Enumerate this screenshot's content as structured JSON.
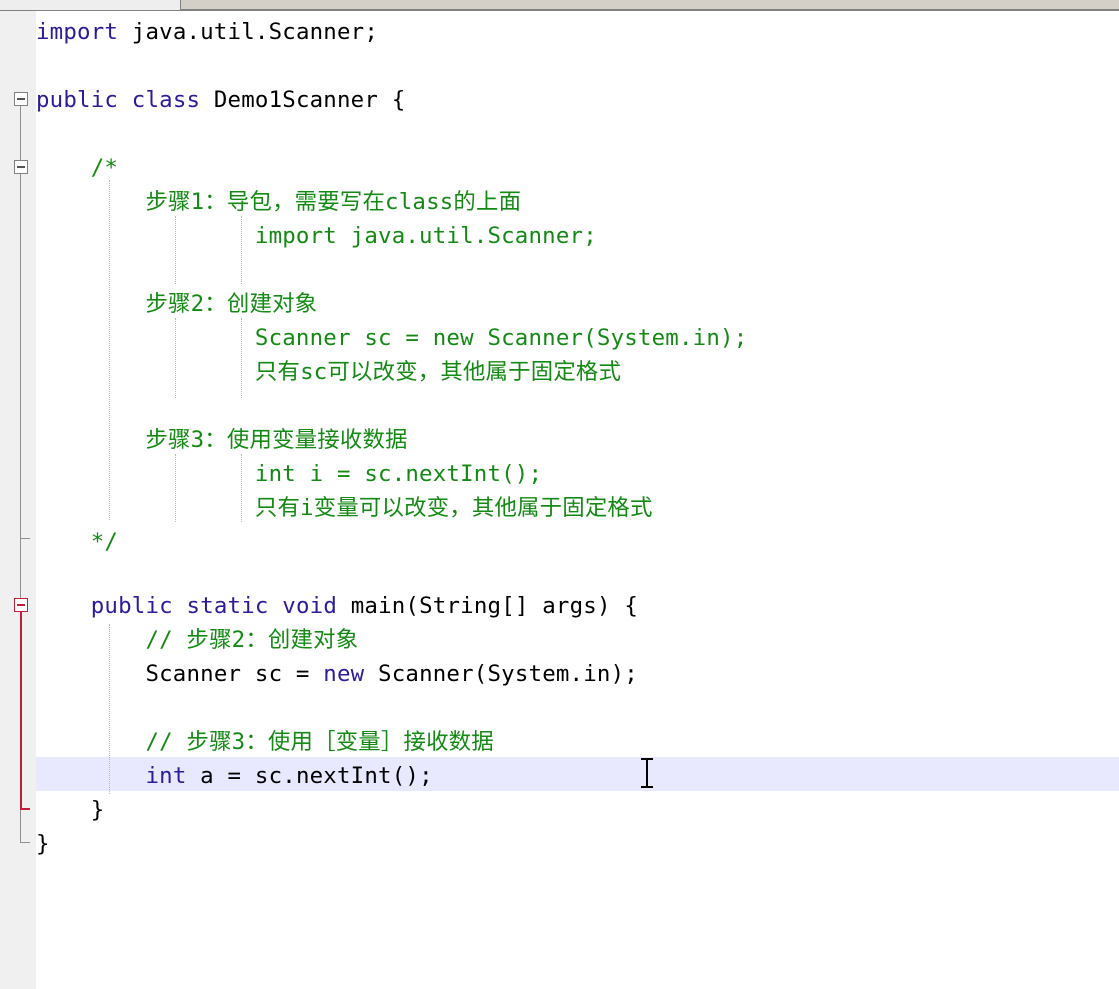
{
  "editor": {
    "lines": [
      {
        "segs": [
          {
            "t": "import",
            "c": "kw"
          },
          {
            "t": " java.util.Scanner;",
            "c": ""
          }
        ]
      },
      {
        "segs": []
      },
      {
        "segs": [
          {
            "t": "public",
            "c": "kw"
          },
          {
            "t": " ",
            "c": ""
          },
          {
            "t": "class",
            "c": "kw"
          },
          {
            "t": " Demo1Scanner {",
            "c": ""
          }
        ]
      },
      {
        "segs": []
      },
      {
        "segs": [
          {
            "t": "    /*",
            "c": "cm"
          }
        ]
      },
      {
        "segs": [
          {
            "t": "        步骤1：导包，需要写在class的上面",
            "c": "cm"
          }
        ]
      },
      {
        "segs": [
          {
            "t": "                import java.util.Scanner;",
            "c": "cm"
          }
        ]
      },
      {
        "segs": []
      },
      {
        "segs": [
          {
            "t": "        步骤2：创建对象",
            "c": "cm"
          }
        ]
      },
      {
        "segs": [
          {
            "t": "                Scanner sc = new Scanner(System.in);",
            "c": "cm"
          }
        ]
      },
      {
        "segs": [
          {
            "t": "                只有sc可以改变，其他属于固定格式",
            "c": "cm"
          }
        ]
      },
      {
        "segs": []
      },
      {
        "segs": [
          {
            "t": "        步骤3：使用变量接收数据",
            "c": "cm"
          }
        ]
      },
      {
        "segs": [
          {
            "t": "                int i = sc.nextInt();",
            "c": "cm"
          }
        ]
      },
      {
        "segs": [
          {
            "t": "                只有i变量可以改变，其他属于固定格式",
            "c": "cm"
          }
        ]
      },
      {
        "segs": [
          {
            "t": "    */",
            "c": "cm"
          }
        ]
      },
      {
        "segs": []
      },
      {
        "segs": [
          {
            "t": "    ",
            "c": ""
          },
          {
            "t": "public",
            "c": "kw"
          },
          {
            "t": " ",
            "c": ""
          },
          {
            "t": "static",
            "c": "kw"
          },
          {
            "t": " ",
            "c": ""
          },
          {
            "t": "void",
            "c": "kw"
          },
          {
            "t": " main(String[] args) {",
            "c": ""
          }
        ]
      },
      {
        "segs": [
          {
            "t": "        // 步骤2：创建对象",
            "c": "cm"
          }
        ]
      },
      {
        "segs": [
          {
            "t": "        Scanner sc = ",
            "c": ""
          },
          {
            "t": "new",
            "c": "kw"
          },
          {
            "t": " Scanner(System.in);",
            "c": ""
          }
        ]
      },
      {
        "segs": []
      },
      {
        "segs": [
          {
            "t": "        // 步骤3：使用［变量］接收数据",
            "c": "cm"
          }
        ]
      },
      {
        "segs": [
          {
            "t": "        ",
            "c": ""
          },
          {
            "t": "int",
            "c": "kw"
          },
          {
            "t": " a = sc.nextInt();",
            "c": ""
          }
        ]
      },
      {
        "segs": [
          {
            "t": "    }",
            "c": ""
          }
        ]
      },
      {
        "segs": [
          {
            "t": "}",
            "c": ""
          }
        ]
      }
    ]
  }
}
